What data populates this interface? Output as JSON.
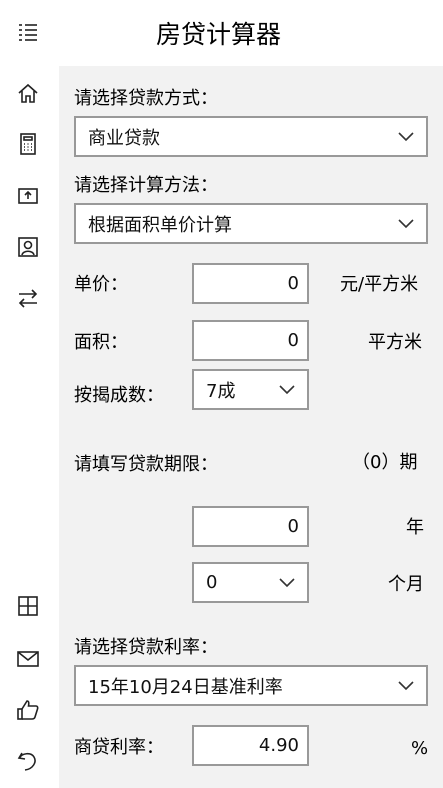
{
  "app": {
    "title": "房贷计算器"
  },
  "sidebar": {
    "items": [
      {
        "icon": "hamburger-menu-icon"
      },
      {
        "icon": "home-icon"
      },
      {
        "icon": "calculator-icon"
      },
      {
        "icon": "upload-box-icon"
      },
      {
        "icon": "contact-card-icon"
      },
      {
        "icon": "swap-arrows-icon"
      },
      {
        "icon": "grid-icon"
      },
      {
        "icon": "mail-icon"
      },
      {
        "icon": "thumbs-up-icon"
      },
      {
        "icon": "undo-icon"
      }
    ]
  },
  "form": {
    "loan_type_label": "请选择贷款方式：",
    "loan_type_value": "商业贷款",
    "calc_method_label": "请选择计算方法：",
    "calc_method_value": "根据面积单价计算",
    "unit_price_label": "单价：",
    "unit_price_value": "0",
    "unit_price_unit": "元/平方米",
    "area_label": "面积：",
    "area_value": "0",
    "area_unit": "平方米",
    "mortgage_ratio_label": "按揭成数：",
    "mortgage_ratio_value": "7成",
    "term_label": "请填写贷款期限：",
    "term_periods_text": "（0）期",
    "years_value": "0",
    "years_unit": "年",
    "months_value": "0",
    "months_unit": "个月",
    "rate_label": "请选择贷款利率：",
    "rate_value": "15年10月24日基准利率",
    "commercial_rate_label": "商贷利率：",
    "commercial_rate_value": "4.90",
    "commercial_rate_unit": "%"
  },
  "colors": {
    "panel_bg": "#f2f2f2",
    "border": "#999999",
    "text": "#000000"
  }
}
